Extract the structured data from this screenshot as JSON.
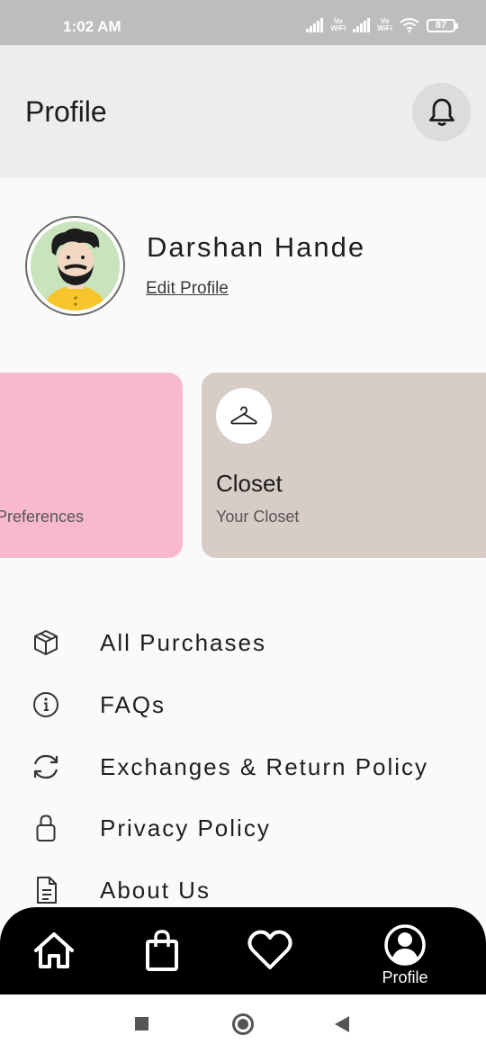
{
  "status_bar": {
    "time": "1:02 AM",
    "vowifi_1": "Vo\nWiFi",
    "vowifi_2": "Vo\nWiFi",
    "battery": "87"
  },
  "header": {
    "title": "Profile",
    "bell_icon": "bell-icon"
  },
  "profile": {
    "name": "Darshan Hande",
    "edit_label": "Edit Profile"
  },
  "cards": [
    {
      "title": "",
      "subtitle": "Preferences",
      "color": "#f8b9cf"
    },
    {
      "title": "Closet",
      "subtitle": "Your Closet",
      "icon": "hanger-icon",
      "color": "#d8ccc7"
    }
  ],
  "menu": [
    {
      "label": "All Purchases",
      "icon": "box-icon"
    },
    {
      "label": "FAQs",
      "icon": "info-icon"
    },
    {
      "label": "Exchanges & Return Policy",
      "icon": "refresh-icon"
    },
    {
      "label": "Privacy Policy",
      "icon": "lock-icon"
    },
    {
      "label": "About Us",
      "icon": "document-icon"
    }
  ],
  "bottom_nav": {
    "items": [
      {
        "icon": "home-icon"
      },
      {
        "icon": "shopping-bag-icon"
      },
      {
        "icon": "heart-icon"
      },
      {
        "icon": "profile-icon",
        "label": "Profile"
      }
    ]
  },
  "colors": {
    "header_bg": "#ededed",
    "nav_bg": "#000000",
    "pink_card": "#f8b9cf",
    "closet_card": "#d8ccc7"
  }
}
